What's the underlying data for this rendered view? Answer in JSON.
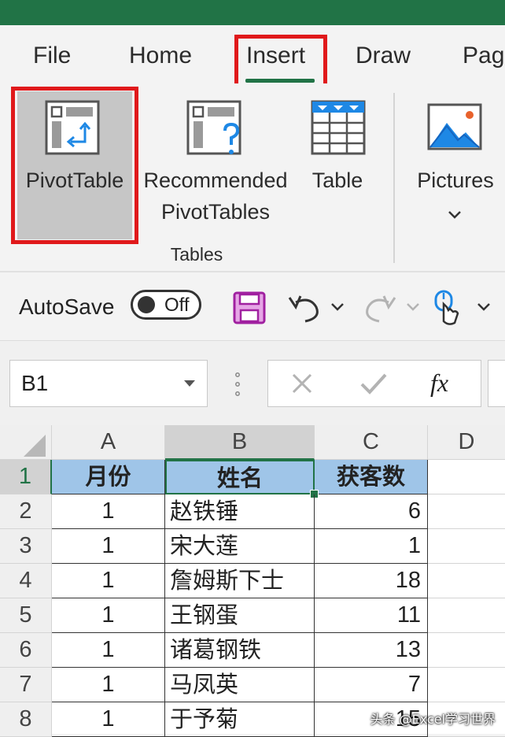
{
  "tabs": [
    "File",
    "Home",
    "Insert",
    "Draw",
    "Pag"
  ],
  "ribbon": {
    "pivottable": "PivotTable",
    "recommended_line1": "Recommended",
    "recommended_line2": "PivotTables",
    "table": "Table",
    "pictures": "Pictures",
    "group_label": "Tables"
  },
  "qat": {
    "autosave_label": "AutoSave",
    "toggle_state": "Off"
  },
  "formula_bar": {
    "name_box": "B1",
    "fx": "fx"
  },
  "columns": [
    "A",
    "B",
    "C",
    "D"
  ],
  "rows": [
    {
      "num": "1",
      "a": "月份",
      "b": "姓名",
      "c": "获客数"
    },
    {
      "num": "2",
      "a": "1",
      "b": "赵铁锤",
      "c": "6"
    },
    {
      "num": "3",
      "a": "1",
      "b": "宋大莲",
      "c": "1"
    },
    {
      "num": "4",
      "a": "1",
      "b": "詹姆斯下士",
      "c": "18"
    },
    {
      "num": "5",
      "a": "1",
      "b": "王钢蛋",
      "c": "11"
    },
    {
      "num": "6",
      "a": "1",
      "b": "诸葛钢铁",
      "c": "13"
    },
    {
      "num": "7",
      "a": "1",
      "b": "马凤英",
      "c": "7"
    },
    {
      "num": "8",
      "a": "1",
      "b": "于予菊",
      "c": "15"
    }
  ],
  "watermark": "头条 @Excel学习世界",
  "colors": {
    "excel_green": "#217346",
    "highlight_red": "#e0191b",
    "header_fill": "#9fc5e8",
    "save_purple": "#a020a0"
  }
}
